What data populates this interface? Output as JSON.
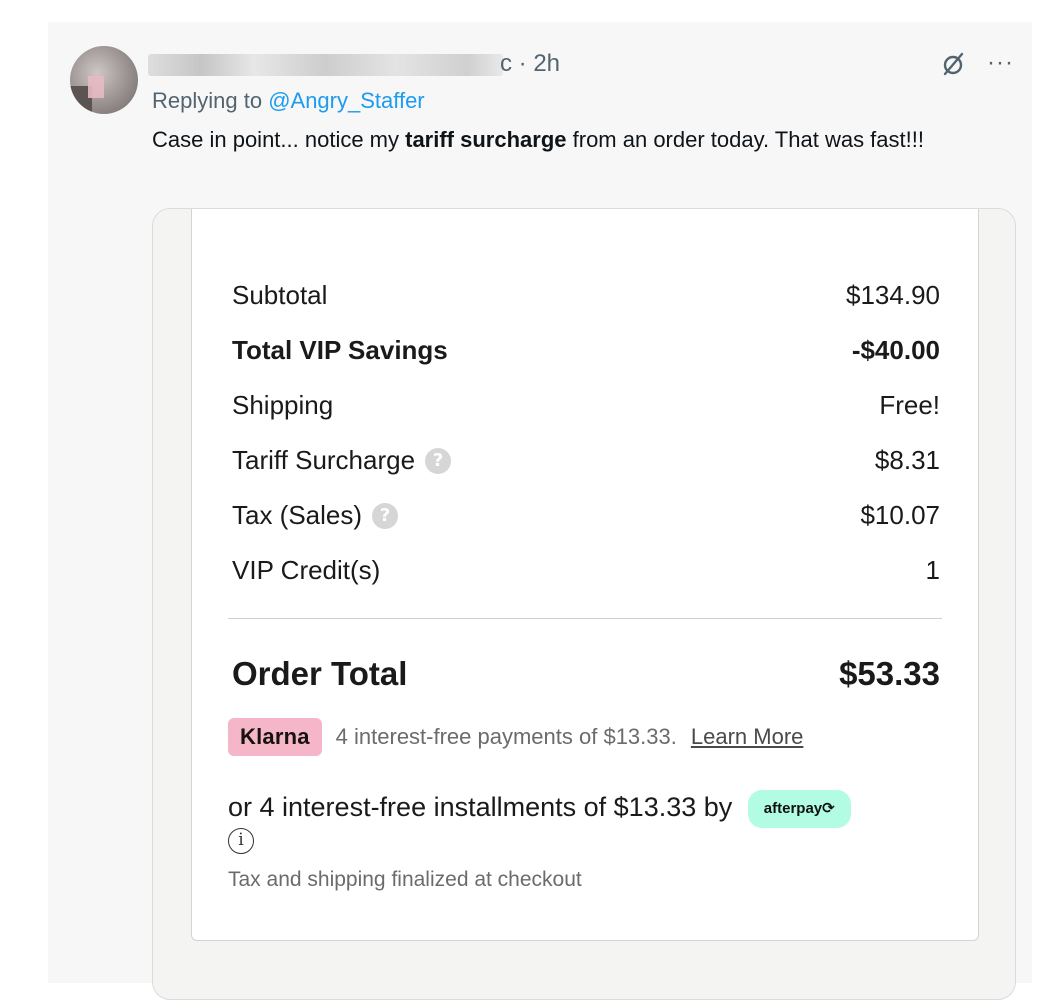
{
  "post": {
    "timestamp_tail": "c · 2h",
    "replying_to_prefix": "Replying to ",
    "replying_to_handle": "@Angry_Staffer",
    "text_before": "Case in point... notice my ",
    "text_bold": "tariff surcharge",
    "text_after": " from an order today. That was fast!!!",
    "more_label": "···"
  },
  "receipt": {
    "rows": [
      {
        "label": "Subtotal",
        "value": "$134.90"
      },
      {
        "label": "Total VIP Savings",
        "value": "-$40.00"
      },
      {
        "label": "Shipping",
        "value": "Free!"
      },
      {
        "label": "Tariff Surcharge",
        "value": "$8.31"
      },
      {
        "label": "Tax (Sales)",
        "value": "$10.07"
      },
      {
        "label": "VIP Credit(s)",
        "value": "1"
      }
    ],
    "help_glyph": "?",
    "total_label": "Order Total",
    "total_value": "$53.33",
    "klarna": {
      "badge": "Klarna",
      "text": "4 interest-free payments of $13.33.",
      "link": "Learn More"
    },
    "afterpay": {
      "text": "or 4 interest-free installments of $13.33 by",
      "badge": "afterpay⟳"
    },
    "info_glyph": "i",
    "footnote": "Tax and shipping finalized at checkout"
  },
  "colors": {
    "link": "#1d9bf0",
    "klarna_pink": "#f4b6c8",
    "afterpay_mint": "#b2fce4"
  },
  "icons": [
    "avatar",
    "grok-icon",
    "more-icon",
    "help-icon",
    "info-icon"
  ]
}
